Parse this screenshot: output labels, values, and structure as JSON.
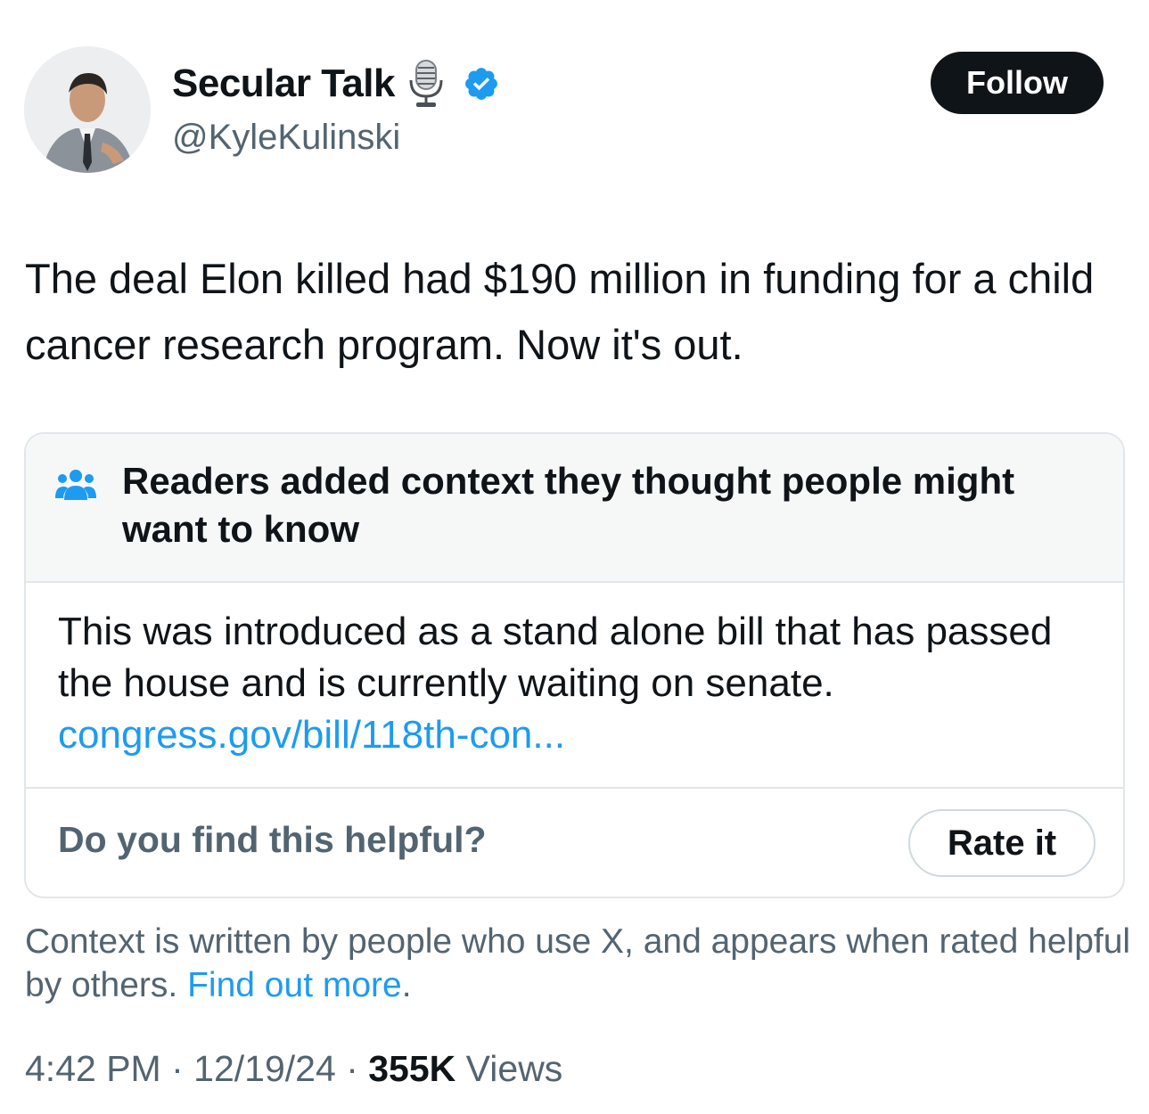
{
  "author": {
    "display_name": "Secular Talk",
    "handle": "@KyleKulinski",
    "name_emoji": "microphone-icon",
    "verified_icon": "verified-badge-icon",
    "verified_color": "#1d9bf0"
  },
  "follow_label": "Follow",
  "tweet": {
    "text": "The deal Elon killed had $190 million in funding for a child cancer research program. Now it's out."
  },
  "community_note": {
    "header_icon": "people-icon",
    "header_title": "Readers added context they thought people might want to know",
    "body": "This was introduced as a stand alone bill that has passed the house and is currently waiting on senate.",
    "link_text": "congress.gov/bill/118th-con...",
    "helpful_question": "Do you find this helpful?",
    "rate_label": "Rate it"
  },
  "context_info": {
    "text": "Context is written by people who use X, and appears when rated helpful by others.",
    "link_text": "Find out more",
    "trailing": "."
  },
  "meta": {
    "time": "4:42 PM",
    "separator": "·",
    "date": "12/19/24",
    "views_count": "355K",
    "views_label": "Views"
  },
  "colors": {
    "link": "#1d9bf0",
    "secondary_text": "#536471",
    "primary_text": "#0f1419",
    "note_header_bg": "#f6f8f8"
  }
}
